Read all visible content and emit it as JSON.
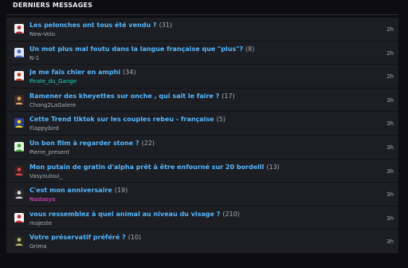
{
  "header": {
    "title": "DERNIERS MESSAGES"
  },
  "topics": [
    {
      "title": "Les pelonches ont tous été vendu ?",
      "count": "(31)",
      "author": "New-Volo",
      "author_color": "#a8adb4",
      "time": "2h",
      "avatar_icon": "user-avatar-icon",
      "avatar_colors": [
        "#f2f2f2",
        "#b02a2a"
      ]
    },
    {
      "title": "Un mot plus mal foutu dans la langue française que \"plus\"?",
      "count": "(8)",
      "author": "N-1",
      "author_color": "#a8adb4",
      "time": "2h",
      "avatar_icon": "user-avatar-icon",
      "avatar_colors": [
        "#dfe6f5",
        "#4a68c9"
      ]
    },
    {
      "title": "Je me fais chier en amphi",
      "count": "(34)",
      "author": "Pirate_du_Gange",
      "author_color": "#1fd3c2",
      "time": "2h",
      "avatar_icon": "user-avatar-icon",
      "avatar_colors": [
        "#f5f5f5",
        "#c0392b"
      ]
    },
    {
      "title": "Ramener des kheyettes sur onche , qui sait le faire ?",
      "count": "(17)",
      "author": "Chong2LaGalere",
      "author_color": "#a8adb4",
      "time": "3h",
      "avatar_icon": "user-avatar-icon",
      "avatar_colors": [
        "#3a2a22",
        "#e0a36b"
      ]
    },
    {
      "title": "Cette Trend tiktok sur les couples rebeu - française",
      "count": "(5)",
      "author": "Flappybird",
      "author_color": "#a8adb4",
      "time": "3h",
      "avatar_icon": "user-avatar-icon",
      "avatar_colors": [
        "#2a3f8f",
        "#f0d020"
      ]
    },
    {
      "title": "Un bon film à regarder stone ?",
      "count": "(22)",
      "author": "Pierre_present",
      "author_color": "#a8adb4",
      "time": "3h",
      "avatar_icon": "user-avatar-icon",
      "avatar_colors": [
        "#e6f5e0",
        "#3aa53a"
      ]
    },
    {
      "title": "Mon putain de gratin d'alpha prêt à être enfourné sur 20 bordelll",
      "count": "(13)",
      "author": "Vasyouloui_",
      "author_color": "#a8adb4",
      "time": "3h",
      "avatar_icon": "user-avatar-icon",
      "avatar_colors": [
        "#3a1f1f",
        "#d94b4b"
      ]
    },
    {
      "title": "C'est mon anniversaire",
      "count": "(19)",
      "author": "Nastasya",
      "author_color": "#ff4fd8",
      "time": "3h",
      "avatar_icon": "user-avatar-icon",
      "avatar_colors": [
        "#2a2a2a",
        "#d9d9d9"
      ]
    },
    {
      "title": "vous ressemblez à quel animal au niveau du visage ?",
      "count": "(210)",
      "author": "majeste",
      "author_color": "#a8adb4",
      "time": "3h",
      "avatar_icon": "user-avatar-icon",
      "avatar_colors": [
        "#f5f5f5",
        "#cc2b2b"
      ]
    },
    {
      "title": "Votre préservatif préféré ?",
      "count": "(10)",
      "author": "Grima",
      "author_color": "#a8adb4",
      "time": "3h",
      "avatar_icon": "user-avatar-icon",
      "avatar_colors": [
        "#1f2a1a",
        "#c9b27a"
      ]
    }
  ]
}
